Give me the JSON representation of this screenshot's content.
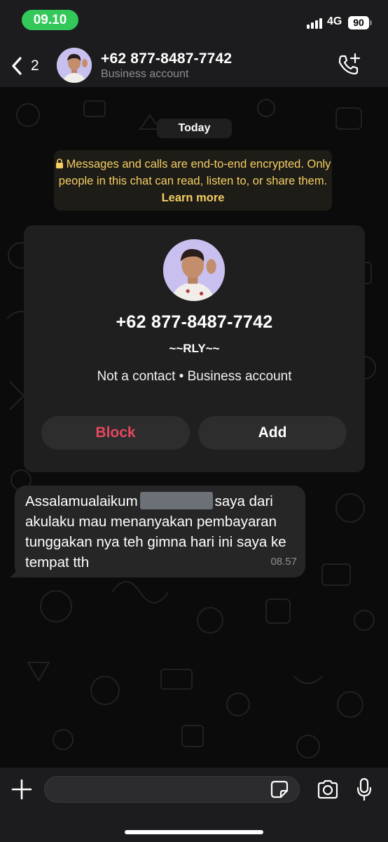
{
  "status_bar": {
    "time": "09.10",
    "network": "4G",
    "battery": "90"
  },
  "header": {
    "back_count": "2",
    "contact_name": "+62 877-8487-7742",
    "subtitle": "Business account"
  },
  "chat": {
    "date_chip": "Today",
    "encryption": {
      "text": "Messages and calls are end-to-end encrypted. Only people in this chat can read, listen to, or share them.",
      "link": "Learn more"
    },
    "profile_card": {
      "phone": "+62 877-8487-7742",
      "about": "~~RLY~~",
      "meta": "Not a contact • Business account",
      "block_label": "Block",
      "add_label": "Add"
    },
    "message": {
      "text_before_redaction": "Assalamualaikum",
      "text_after_redaction": "saya dari akulaku mau menanyakan pembayaran tunggakan nya teh gimna hari ini saya ke tempat tth",
      "time": "08.57"
    }
  },
  "input_bar": {
    "placeholder": ""
  },
  "colors": {
    "accent_green": "#34c759",
    "notice_yellow": "#f4ce63",
    "block_red": "#e5475e"
  },
  "icons": [
    "back-chevron-icon",
    "call-add-icon",
    "lock-icon",
    "plus-icon",
    "sticker-icon",
    "camera-icon",
    "microphone-icon"
  ]
}
